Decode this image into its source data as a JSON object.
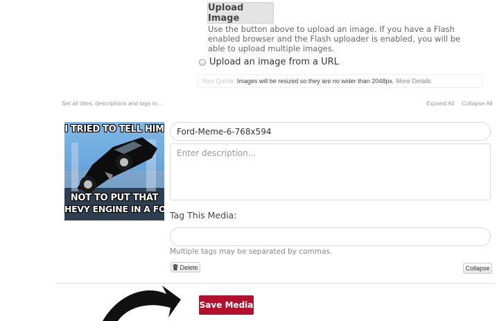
{
  "upload": {
    "button_label": "Upload Image",
    "help_text": "Use the button above to upload an image. If you have a Flash enabled browser and the Flash uploader is enabled, you will be able to upload multiple images."
  },
  "url_option": {
    "label": "Upload an image from a URL"
  },
  "quota": {
    "label": "Your Quota:",
    "text": "Images will be resized so they are no wider than 2048px.",
    "link": "More Details"
  },
  "bulk": {
    "set_all": "Set all titles, descriptions and tags to...",
    "expand_all": "Expand All",
    "collapse_all": "Collapse All"
  },
  "media": {
    "thumbnail_caption_top": "I TRIED TO TELL HIM",
    "thumbnail_caption_bottom_1": "NOT TO PUT THAT",
    "thumbnail_caption_bottom_2": "HEVY ENGINE IN A FOR",
    "title_value": "Ford-Meme-6-768x594",
    "description_placeholder": "Enter description...",
    "tag_heading": "Tag This Media:",
    "tag_value": "",
    "tag_help": "Multiple tags may be separated by commas.",
    "delete_label": "Delete",
    "collapse_label": "Collapse"
  },
  "actions": {
    "save_label": "Save Media"
  },
  "colors": {
    "save_button": "#b2112e",
    "annotation_arrow": "#111111"
  },
  "icons": {
    "delete": "trash-icon",
    "arrow": "curved-arrow-icon"
  }
}
